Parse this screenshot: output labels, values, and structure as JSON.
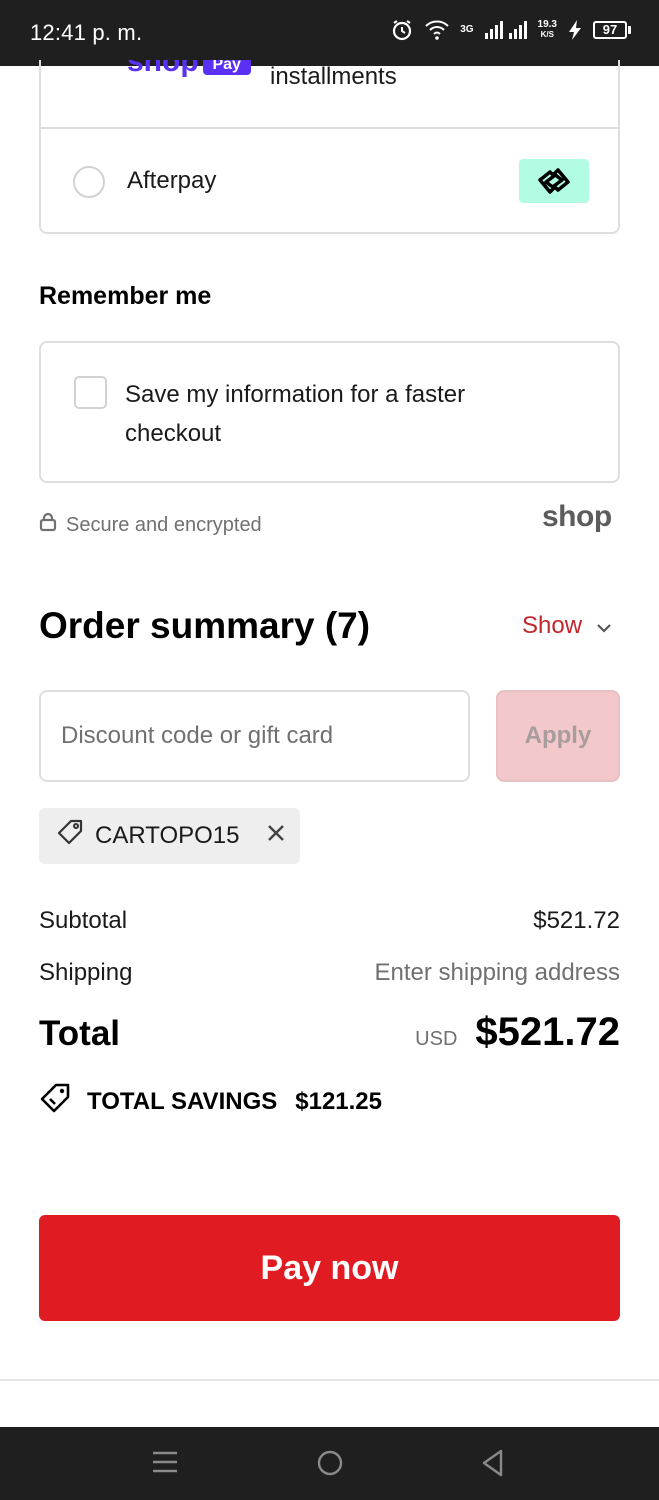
{
  "status_bar": {
    "time": "12:41 p. m.",
    "network_type": "3G",
    "speed_value": "19.3",
    "speed_unit": "K/S",
    "battery": "97"
  },
  "payment": {
    "shoppay_word": "shop",
    "shoppay_pay": "Pay",
    "installments_text": "installments",
    "afterpay_label": "Afterpay"
  },
  "remember": {
    "title": "Remember me",
    "checkbox_label": "Save my information for a faster checkout"
  },
  "secure": {
    "text": "Secure and encrypted",
    "shop_logo": "shop"
  },
  "summary": {
    "title": "Order summary (7)",
    "toggle_label": "Show",
    "discount_placeholder": "Discount code or gift card",
    "apply_label": "Apply",
    "applied_code": "CARTOPO15",
    "subtotal_label": "Subtotal",
    "subtotal_value": "$521.72",
    "shipping_label": "Shipping",
    "shipping_value": "Enter shipping address",
    "total_label": "Total",
    "currency": "USD",
    "total_value": "$521.72",
    "savings_label": "TOTAL SAVINGS",
    "savings_value": "$121.25"
  },
  "pay_button": "Pay now",
  "colors": {
    "accent_red": "#e11b22",
    "link_red": "#c1272d",
    "shoppay_purple": "#5a31f4",
    "afterpay_mint": "#b2fce4"
  },
  "icons": {
    "alarm": "alarm-icon",
    "wifi": "wifi-icon",
    "signal": "signal-icon",
    "charging": "charging-icon",
    "lock": "lock-icon",
    "chevron": "chevron-down-icon",
    "tag": "tag-icon",
    "close": "close-icon",
    "savings": "savings-tag-icon",
    "nav_menu": "recent-apps-icon",
    "nav_home": "home-icon",
    "nav_back": "back-icon"
  }
}
